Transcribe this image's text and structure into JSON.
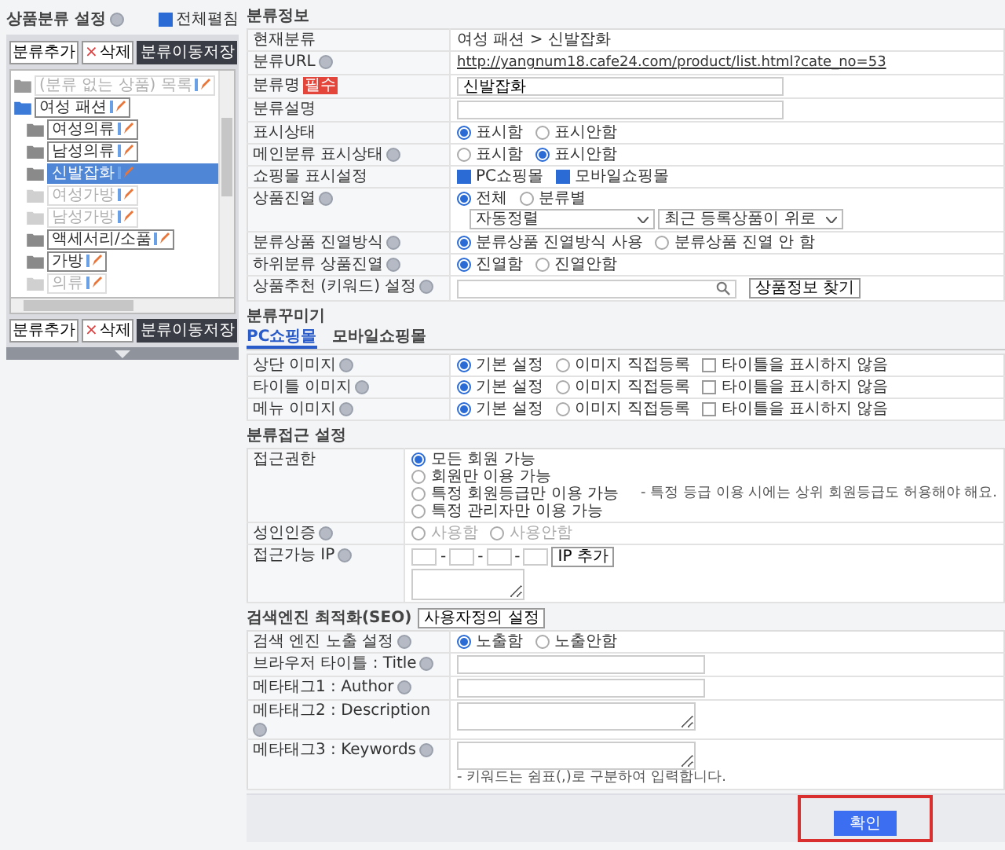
{
  "sidebar": {
    "title": "상품분류 설정",
    "expand_all": {
      "label": "전체펼침",
      "checked": true
    },
    "top_buttons": [
      {
        "label": "분류추가",
        "kind": "plain"
      },
      {
        "label": "삭제",
        "kind": "delete",
        "icon": "×"
      },
      {
        "label": "분류이동저장",
        "kind": "dark"
      }
    ],
    "tree": [
      {
        "label": "(분류 없는 상품) 목록",
        "visible": false,
        "selected": false,
        "expanded": false
      },
      {
        "label": "여성 패션",
        "visible": true,
        "selected": false,
        "expanded": true,
        "children": [
          {
            "label": "여성의류",
            "visible": true,
            "selected": false
          },
          {
            "label": "남성의류",
            "visible": true,
            "selected": false
          },
          {
            "label": "신발잡화",
            "visible": true,
            "selected": true
          },
          {
            "label": "여성가방",
            "visible": false,
            "selected": false
          },
          {
            "label": "남성가방",
            "visible": false,
            "selected": false
          },
          {
            "label": "액세서리/소품",
            "visible": true,
            "selected": false
          },
          {
            "label": "가방",
            "visible": true,
            "selected": false
          },
          {
            "label": "의류",
            "visible": false,
            "selected": false
          }
        ]
      }
    ],
    "bottom_buttons": [
      {
        "label": "분류추가",
        "kind": "plain"
      },
      {
        "label": "삭제",
        "kind": "delete",
        "icon": "×"
      },
      {
        "label": "분류이동저장",
        "kind": "dark"
      }
    ]
  },
  "category_info": {
    "title": "분류정보",
    "rows": [
      {
        "label": "현재분류",
        "kind": "text",
        "value": "여성 패션 > 신발잡화"
      },
      {
        "label": "분류URL",
        "help": true,
        "kind": "link",
        "value": "http://yangnum18.cafe24.com/product/list.html?cate_no=53"
      },
      {
        "label": "분류명",
        "badge": "필수",
        "kind": "input",
        "value": "신발잡화"
      },
      {
        "label": "분류설명",
        "kind": "input"
      },
      {
        "label": "표시상태",
        "kind": "radio",
        "options": [
          {
            "label": "표시함",
            "selected": true
          },
          {
            "label": "표시안함",
            "selected": false
          }
        ]
      },
      {
        "label": "메인분류 표시상태",
        "help": true,
        "kind": "radio",
        "options": [
          {
            "label": "표시함",
            "selected": false
          },
          {
            "label": "표시안함",
            "selected": true
          }
        ]
      },
      {
        "label": "쇼핑몰 표시설정",
        "kind": "checkbox",
        "options": [
          {
            "label": "PC쇼핑몰",
            "checked": true
          },
          {
            "label": "모바일쇼핑몰",
            "checked": true
          }
        ]
      },
      {
        "label": "상품진열",
        "help": true,
        "kind": "radio",
        "options": [
          {
            "label": "전체",
            "selected": true
          },
          {
            "label": "분류별",
            "selected": false
          }
        ],
        "selects": [
          {
            "value": "자동정렬"
          },
          {
            "value": "최근 등록상품이 위로"
          }
        ]
      },
      {
        "label": "분류상품 진열방식",
        "help": true,
        "kind": "radio",
        "options": [
          {
            "label": "분류상품 진열방식 사용",
            "selected": true
          },
          {
            "label": "분류상품 진열 안 함",
            "selected": false
          }
        ]
      },
      {
        "label": "하위분류 상품진열",
        "help": true,
        "kind": "radio",
        "options": [
          {
            "label": "진열함",
            "selected": true
          },
          {
            "label": "진열안함",
            "selected": false
          }
        ]
      },
      {
        "label": "상품추천 (키워드) 설정",
        "help": true,
        "kind": "search",
        "button": "상품정보 찾기"
      }
    ]
  },
  "decoration": {
    "title": "분류꾸미기",
    "tabs": [
      {
        "label": "PC쇼핑몰",
        "selected": true
      },
      {
        "label": "모바일쇼핑몰",
        "selected": false
      }
    ],
    "rows": [
      {
        "label": "상단 이미지",
        "help": true,
        "kind": "radio",
        "options": [
          {
            "label": "기본 설정",
            "selected": true
          },
          {
            "label": "이미지 직접등록",
            "selected": false
          }
        ],
        "checks": [
          {
            "label": "타이틀을 표시하지 않음",
            "checked": false
          }
        ]
      },
      {
        "label": "타이틀 이미지",
        "help": true,
        "kind": "radio",
        "options": [
          {
            "label": "기본 설정",
            "selected": true
          },
          {
            "label": "이미지 직접등록",
            "selected": false
          }
        ],
        "checks": [
          {
            "label": "타이틀을 표시하지 않음",
            "checked": false
          }
        ]
      },
      {
        "label": "메뉴 이미지",
        "help": true,
        "kind": "radio",
        "options": [
          {
            "label": "기본 설정",
            "selected": true
          },
          {
            "label": "이미지 직접등록",
            "selected": false
          }
        ],
        "checks": [
          {
            "label": "타이틀을 표시하지 않음",
            "checked": false
          }
        ]
      }
    ]
  },
  "access": {
    "title": "분류접근 설정",
    "rows": [
      {
        "label": "접근권한",
        "kind": "radio_list",
        "options": [
          {
            "label": "모든 회원 가능",
            "selected": true
          },
          {
            "label": "회원만 이용 가능",
            "selected": false
          },
          {
            "label": "특정 회원등급만 이용 가능",
            "selected": false,
            "note": "- 특정 등급 이용 시에는 상위 회원등급도 허용해야 해요."
          },
          {
            "label": "특정 관리자만 이용 가능",
            "selected": false
          }
        ]
      },
      {
        "label": "성인인증",
        "help": true,
        "kind": "radio",
        "disabled": true,
        "options": [
          {
            "label": "사용함",
            "selected": false
          },
          {
            "label": "사용안함",
            "selected": false
          }
        ]
      },
      {
        "label": "접근가능 IP",
        "help": true,
        "kind": "ip",
        "separators": [
          "-",
          "-",
          "-"
        ],
        "button": "IP 추가"
      }
    ]
  },
  "seo": {
    "title": "검색엔진 최적화(SEO)",
    "button": "사용자정의 설정",
    "rows": [
      {
        "label": "검색 엔진 노출 설정",
        "help": true,
        "kind": "radio",
        "options": [
          {
            "label": "노출함",
            "selected": true
          },
          {
            "label": "노출안함",
            "selected": false
          }
        ]
      },
      {
        "label": "브라우저 타이틀 : Title",
        "help": true,
        "kind": "input"
      },
      {
        "label": "메타태그1 : Author",
        "help": true,
        "kind": "input"
      },
      {
        "label": "메타태그2 : Description",
        "help": true,
        "kind": "textarea"
      },
      {
        "label": "메타태그3 : Keywords",
        "help": true,
        "kind": "textarea",
        "note": "- 키워드는 쉼표(,)로 구분하여 입력합니다."
      }
    ]
  },
  "footer": {
    "confirm": "확인",
    "highlighted": true
  }
}
